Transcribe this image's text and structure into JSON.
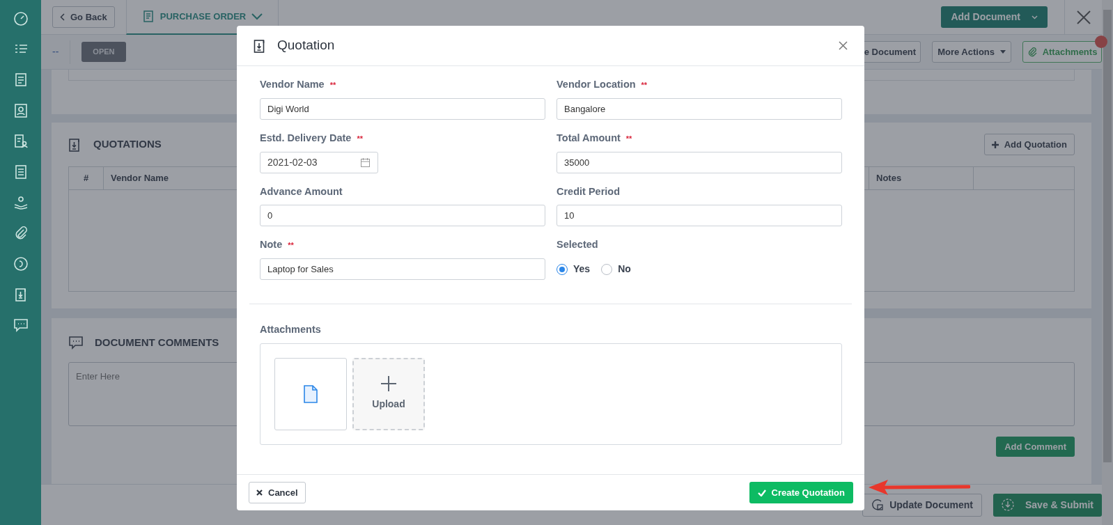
{
  "header": {
    "back_button": "Go Back",
    "module_tab": "PURCHASE ORDER",
    "add_document_button": "Add Document"
  },
  "toolbar": {
    "dash": "--",
    "status_badge": "OPEN",
    "buttons": [
      "e Document",
      "More Actions",
      "Attachments"
    ]
  },
  "quotations_section": {
    "title": "QUOTATIONS",
    "add_button": "Add Quotation",
    "table": {
      "columns": [
        "#",
        "Vendor Name",
        "Notes"
      ]
    }
  },
  "comments_section": {
    "title": "DOCUMENT COMMENTS",
    "placeholder": "Enter Here",
    "add_button": "Add Comment"
  },
  "footer_bar": {
    "buttons": [
      "Update Document",
      "Save & Submit"
    ]
  },
  "modal": {
    "title": "Quotation",
    "fields": [
      {
        "label": "Vendor Name",
        "required_mark": "**",
        "kind": "text",
        "value": "Digi World"
      },
      {
        "label": "Vendor Location",
        "required_mark": "**",
        "kind": "text",
        "value": "Bangalore"
      },
      {
        "label": "Estd. Delivery Date",
        "required_mark": "**",
        "kind": "date",
        "value": "2021-02-03"
      },
      {
        "label": "Total Amount",
        "required_mark": "**",
        "kind": "text",
        "value": "35000"
      },
      {
        "label": "Advance Amount",
        "kind": "text",
        "value": "0"
      },
      {
        "label": "Credit Period",
        "kind": "text",
        "value": "10"
      },
      {
        "label": "Note",
        "required_mark": "**",
        "kind": "text",
        "value": "Laptop for Sales"
      },
      {
        "label": "Selected",
        "kind": "radio",
        "options": [
          {
            "label": "Yes",
            "selected": true
          },
          {
            "label": "No",
            "selected": false
          }
        ]
      }
    ],
    "attachments": {
      "label": "Attachments",
      "upload_label": "Upload"
    },
    "cancel_button": "Cancel",
    "submit_button": "Create Quotation"
  }
}
